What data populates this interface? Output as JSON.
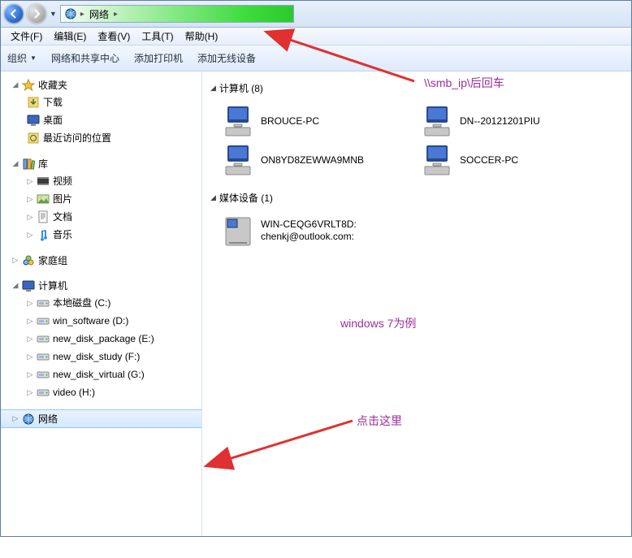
{
  "breadcrumb": {
    "root_label": "网络"
  },
  "menubar": [
    {
      "label": "文件(F)"
    },
    {
      "label": "编辑(E)"
    },
    {
      "label": "查看(V)"
    },
    {
      "label": "工具(T)"
    },
    {
      "label": "帮助(H)"
    }
  ],
  "toolbar": [
    {
      "label": "组织"
    },
    {
      "label": "网络和共享中心"
    },
    {
      "label": "添加打印机"
    },
    {
      "label": "添加无线设备"
    }
  ],
  "sidebar": {
    "favorites": {
      "label": "收藏夹",
      "children": [
        {
          "label": "下载"
        },
        {
          "label": "桌面"
        },
        {
          "label": "最近访问的位置"
        }
      ]
    },
    "libraries": {
      "label": "库",
      "children": [
        {
          "label": "视频"
        },
        {
          "label": "图片"
        },
        {
          "label": "文档"
        },
        {
          "label": "音乐"
        }
      ]
    },
    "homegroup": {
      "label": "家庭组"
    },
    "computer": {
      "label": "计算机",
      "children": [
        {
          "label": "本地磁盘 (C:)"
        },
        {
          "label": "win_software (D:)"
        },
        {
          "label": "new_disk_package (E:)"
        },
        {
          "label": "new_disk_study (F:)"
        },
        {
          "label": "new_disk_virtual (G:)"
        },
        {
          "label": "video (H:)"
        }
      ]
    },
    "network": {
      "label": "网络"
    }
  },
  "main": {
    "computers": {
      "header": "计算机 (8)",
      "items": [
        {
          "label": "BROUCE-PC"
        },
        {
          "label": "DN--20121201PIU"
        },
        {
          "label": "ON8YD8ZEWWA9MNB"
        },
        {
          "label": "SOCCER-PC"
        }
      ]
    },
    "media": {
      "header": "媒体设备 (1)",
      "items": [
        {
          "line1": "WIN-CEQG6VRLT8D:",
          "line2": "chenkj@outlook.com:"
        }
      ]
    }
  },
  "annotations": {
    "addr_hint": "\\\\smb_ip\\后回车",
    "example": "windows 7为例",
    "click_here": "点击这里"
  }
}
